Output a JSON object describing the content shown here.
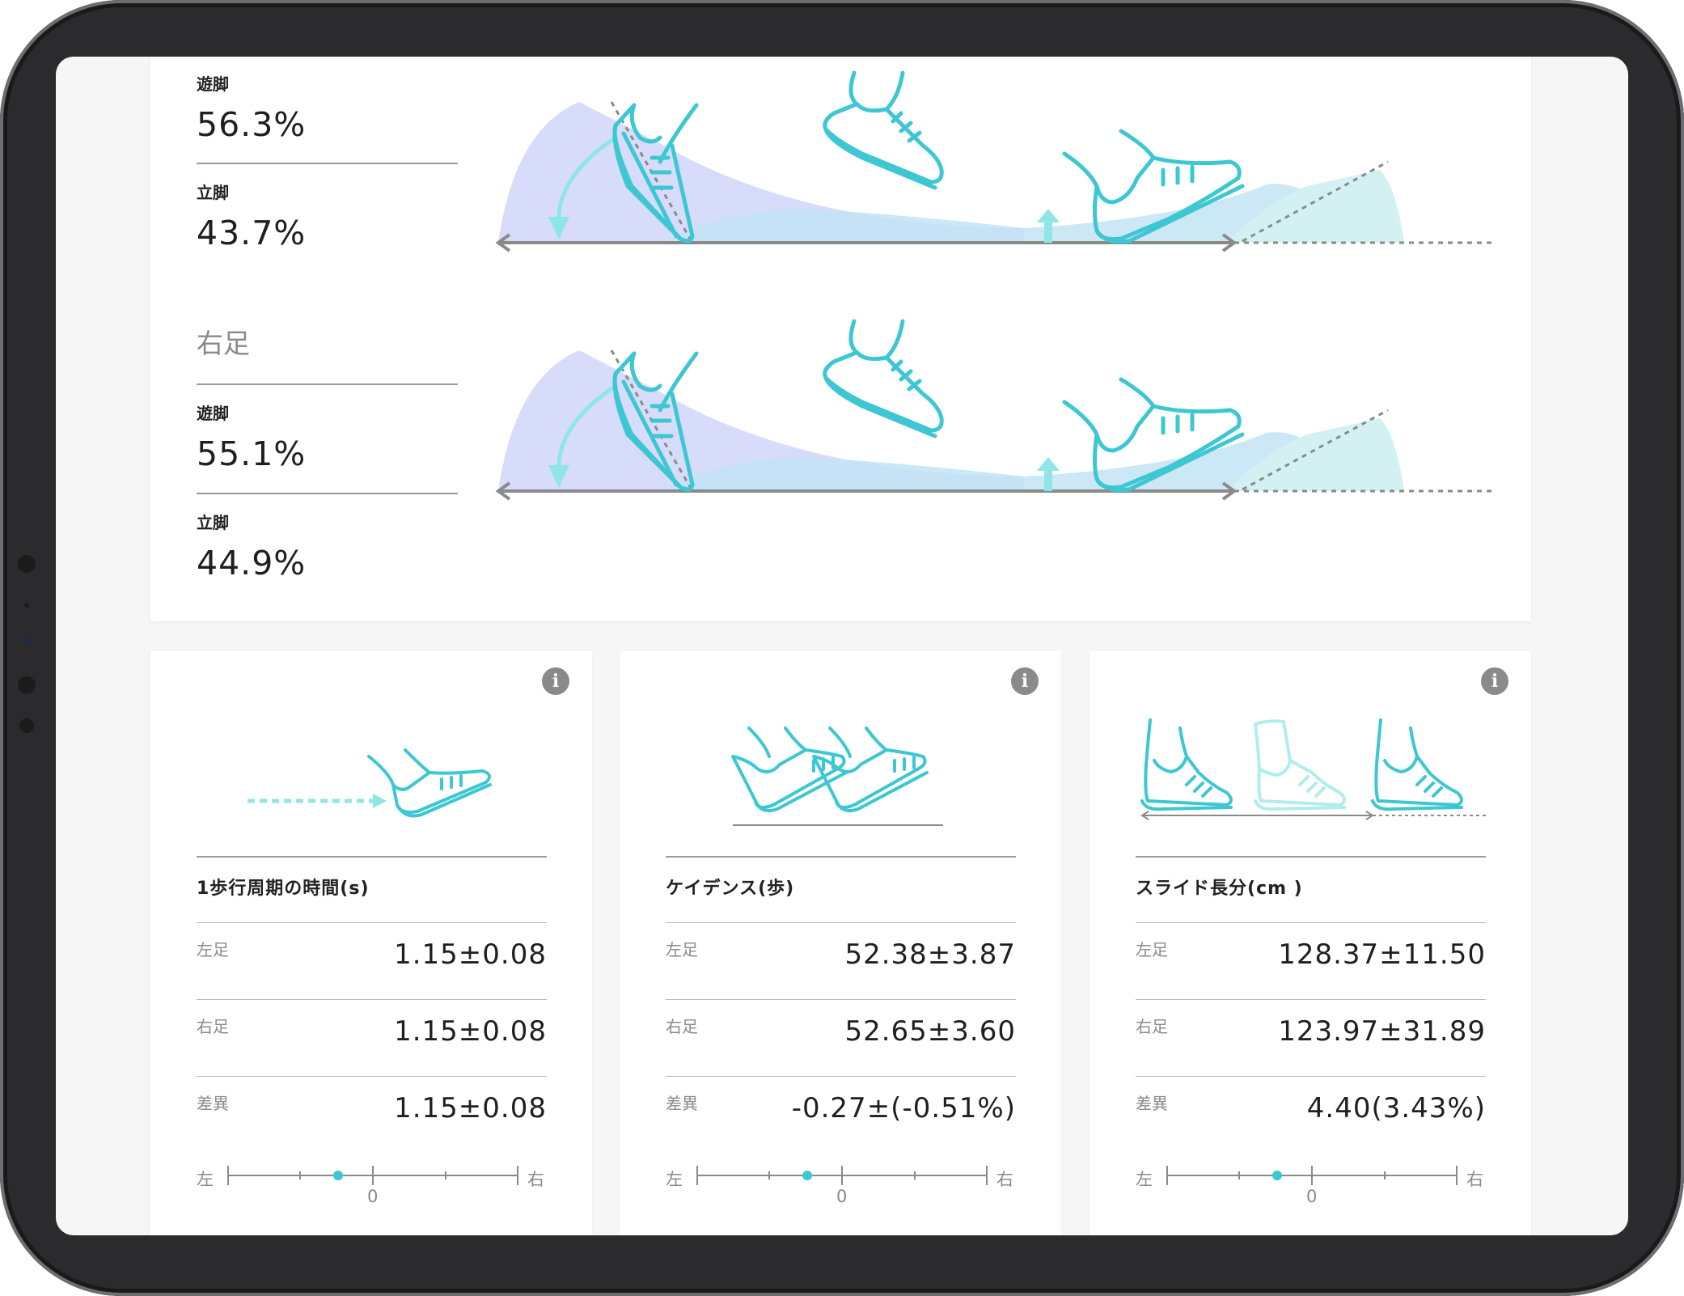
{
  "top_panel": {
    "left_foot": {
      "swing_label": "遊脚",
      "swing_value": "56.3%",
      "stance_label": "立脚",
      "stance_value": "43.7%"
    },
    "right_foot": {
      "title": "右足",
      "swing_label": "遊脚",
      "swing_value": "55.1%",
      "stance_label": "立脚",
      "stance_value": "44.9%"
    }
  },
  "cards": [
    {
      "title": "1歩行周期の時間(s)",
      "rows": [
        {
          "label": "左足",
          "value": "1.15±0.08"
        },
        {
          "label": "右足",
          "value": "1.15±0.08"
        },
        {
          "label": "差異",
          "value": "1.15±0.08"
        }
      ],
      "scale": {
        "left": "左",
        "right": "右",
        "zero": "0"
      }
    },
    {
      "title": "ケイデンス(歩)",
      "rows": [
        {
          "label": "左足",
          "value": "52.38±3.87"
        },
        {
          "label": "右足",
          "value": "52.65±3.60"
        },
        {
          "label": "差異",
          "value": "-0.27±(-0.51%)"
        }
      ],
      "scale": {
        "left": "左",
        "right": "右",
        "zero": "0"
      }
    },
    {
      "title": "スライド長分(cm )",
      "rows": [
        {
          "label": "左足",
          "value": "128.37±11.50"
        },
        {
          "label": "右足",
          "value": "123.97±31.89"
        },
        {
          "label": "差異",
          "value": "4.40(3.43%)"
        }
      ],
      "scale": {
        "left": "左",
        "right": "右",
        "zero": "0"
      }
    }
  ],
  "icons": {
    "info": "info-icon",
    "shoe": "shoe-icon"
  },
  "colors": {
    "accent": "#3cc7d2",
    "swing_fill": "#d9dcfb",
    "stance_fill": "#c6ecf2",
    "arrow": "#8fe6e6",
    "marker": "#3cc7d2"
  }
}
